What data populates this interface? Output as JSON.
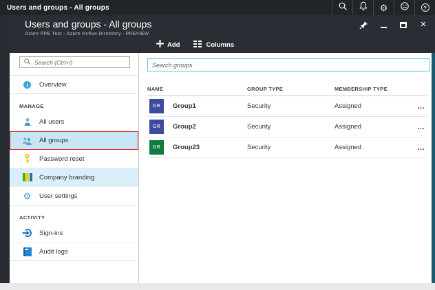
{
  "topbar": {
    "title": "Users and groups - All groups"
  },
  "blade": {
    "title": "Users and groups - All groups",
    "subtitle": "Azure PPE Test - Azure Active Directory - PREVIEW",
    "toolbar": {
      "add": "Add",
      "columns": "Columns"
    }
  },
  "sidebar": {
    "search_placeholder": "Search (Ctrl+/)",
    "overview": "Overview",
    "manage_header": "MANAGE",
    "all_users": "All users",
    "all_groups": "All groups",
    "password_reset": "Password reset",
    "company_branding": "Company branding",
    "user_settings": "User settings",
    "activity_header": "ACTIVITY",
    "sign_ins": "Sign-ins",
    "audit_logs": "Audit logs"
  },
  "main": {
    "search_placeholder": "Search groups",
    "table": {
      "columns": [
        "NAME",
        "GROUP TYPE",
        "MEMBERSHIP TYPE"
      ],
      "rows": [
        {
          "avatar": "GR",
          "avatar_style": "background:#3c4b9e",
          "name": "Group1",
          "group_type": "Security",
          "membership_type": "Assigned",
          "menu": "…"
        },
        {
          "avatar": "GR",
          "avatar_style": "background:#3c4b9e",
          "name": "Group2",
          "group_type": "Security",
          "membership_type": "Assigned",
          "menu": "…"
        },
        {
          "avatar": "GR",
          "avatar_style": "background:#0f7c42",
          "name": "Group23",
          "group_type": "Security",
          "membership_type": "Assigned",
          "menu": "…"
        }
      ]
    }
  },
  "glyphs": {
    "info": "i",
    "help": "?",
    "close": "✕",
    "gear_white": "⚙",
    "gear_blue": "⚙"
  },
  "colors": {
    "selected_border": "#e32222",
    "selected_bg": "#c7e7f6",
    "hover_bg": "#d9eff9",
    "search_border": "#53c0e8",
    "avatar_blue": "#3c4b9e",
    "avatar_green": "#0f7c42",
    "edge_strip": "#1a5a70"
  }
}
